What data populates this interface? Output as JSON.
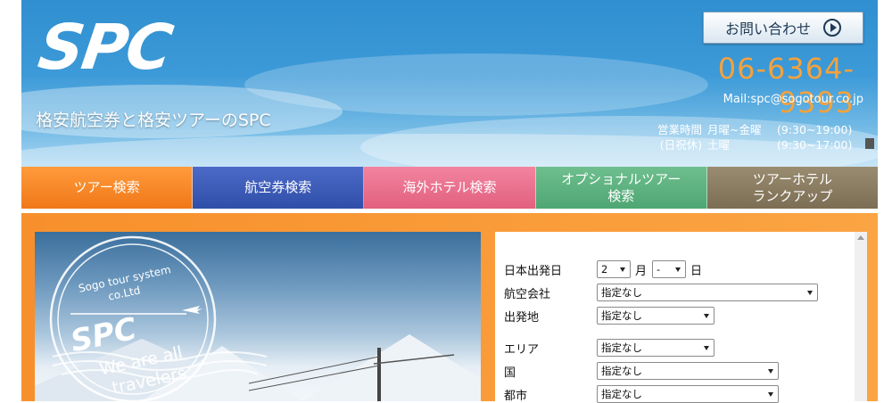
{
  "header": {
    "logo": "SPC",
    "tagline": "格安航空券と格安ツアーのSPC",
    "contact_button": "お問い合わせ",
    "phone": "06-6364-9393",
    "mail": "Mail:spc@sogotour.co.jp",
    "hours": [
      {
        "label": "営業時間",
        "days": "月曜~金曜",
        "time": "(9:30~19:00)"
      },
      {
        "label": "(日祝休)",
        "days": "土曜",
        "time": "(9:30~17:00)"
      }
    ]
  },
  "nav": {
    "tabs": [
      {
        "label": "ツアー検索"
      },
      {
        "label": "航空券検索"
      },
      {
        "label": "海外ホテル検索"
      },
      {
        "label": "オプショナルツアー\n検索"
      },
      {
        "label": "ツアーホテル\nランクアップ"
      }
    ]
  },
  "photo": {
    "stamp_line1": "Sogo tour system",
    "stamp_line2": "co.Ltd",
    "stamp_logo": "SPC",
    "stamp_slogan1": "We are all",
    "stamp_slogan2": "travelers"
  },
  "form": {
    "departure_date_label": "日本出発日",
    "month_value": "2",
    "month_unit": "月",
    "day_value": "-",
    "day_unit": "日",
    "airline_label": "航空会社",
    "airline_value": "指定なし",
    "origin_label": "出発地",
    "origin_value": "指定なし",
    "area_label": "エリア",
    "area_value": "指定なし",
    "country_label": "国",
    "country_value": "指定なし",
    "city_label": "都市",
    "city_value": "指定なし"
  }
}
